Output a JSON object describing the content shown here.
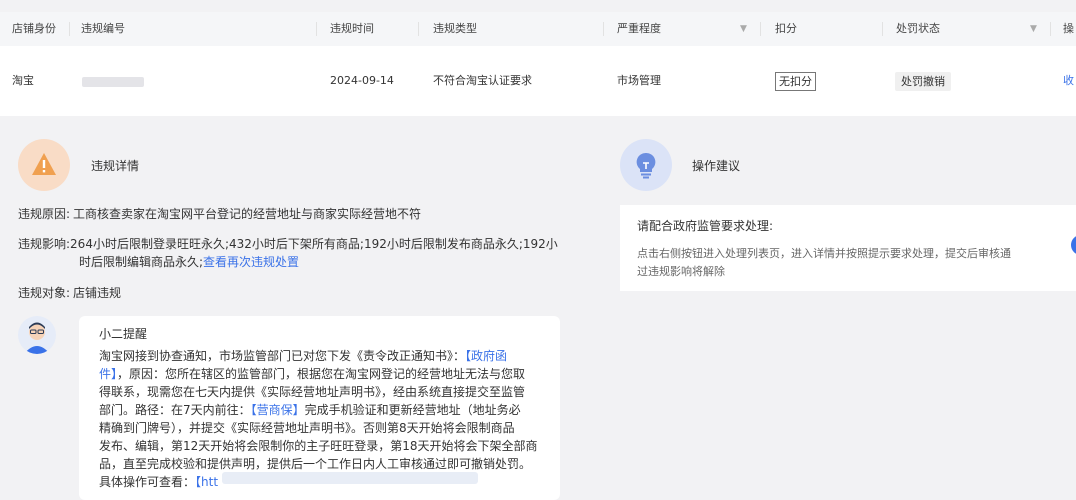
{
  "table": {
    "headers": [
      "店铺身份",
      "违规编号",
      "违规时间",
      "违规类型",
      "严重程度",
      "扣分",
      "处罚状态",
      "操"
    ],
    "row": {
      "shop_identity": "淘宝",
      "time": "2024-09-14",
      "type": "不符合淘宝认证要求",
      "severity": "市场管理",
      "deduction": "无扣分",
      "status": "处罚撤销",
      "action": "收"
    }
  },
  "details": {
    "title": "违规详情",
    "reason_label": "违规原因:",
    "reason_value": "工商核查卖家在淘宝网平台登记的经营地址与商家实际经营地不符",
    "impact_label": "违规影响:",
    "impact_line1": "264小时后限制登录旺旺永久;432小时后下架所有商品;192小时后限制发布商品永久;192小",
    "impact_line2_prefix": "时后限制编辑商品永久;",
    "impact_link": "查看再次违规处置",
    "target_label": "违规对象:",
    "target_value": "店铺违规"
  },
  "tip": {
    "title": "小二提醒",
    "lines": [
      [
        "淘宝网接到协查通知，市场监管部门已对您下发《责令改正通知书》：",
        "【政府函"
      ],
      [
        "件】",
        "，原因：您所在辖区的监管部门，根据您在淘宝网登记的经营地址无法与您取"
      ],
      [
        "得联系，现需您在七天内提供《实际经营地址声明书》，经由系统直接提交至监管"
      ],
      [
        "部门。路径：在7天内前往：",
        "【营商保】",
        "完成手机验证和更新经营地址（地址务必"
      ],
      [
        "精确到门牌号），并提交《实际经营地址声明书》。否则第8天开始将会限制商品"
      ],
      [
        "发布、编辑，第12天开始将会限制你的主子旺旺登录，第18天开始将会下架全部商"
      ],
      [
        "品，直至完成校验和提供声明，提供后一个工作日内人工审核通过即可撤销处罚。"
      ]
    ],
    "last_prefix": "具体操作可查看：",
    "last_link": "【htt"
  },
  "advice": {
    "title": "操作建议",
    "heading": "请配合政府监管要求处理:",
    "body_line1": "点击右侧按钮进入处理列表页，进入详情并按照提示要求处理，提交后审核通",
    "body_line2": "过违规影响将解除"
  },
  "colors": {
    "link": "#3a72e8",
    "warn": "#f0a050",
    "bulb": "#6b8ee0"
  }
}
